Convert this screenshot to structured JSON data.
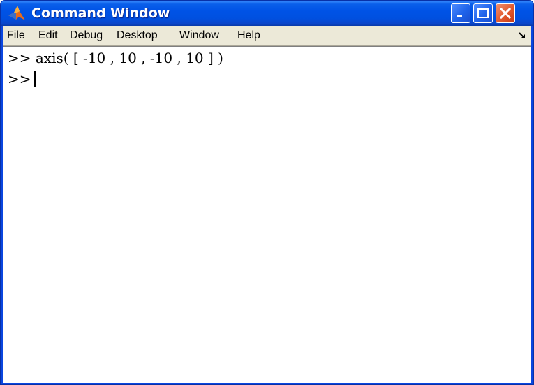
{
  "window": {
    "title": "Command Window",
    "app_icon": "matlab-icon",
    "controls": [
      "minimize-icon",
      "maximize-icon",
      "close-icon"
    ]
  },
  "menu": {
    "items": [
      "File",
      "Edit",
      "Debug",
      "Desktop",
      "Window",
      "Help"
    ],
    "undock_icon": "undock-arrow-icon"
  },
  "console": {
    "lines": [
      {
        "prompt": ">>",
        "command": "axis( [ -10 , 10 , -10 , 10 ] )"
      },
      {
        "prompt": ">>",
        "command": ""
      }
    ]
  },
  "colors": {
    "titlebar": "#0053e6",
    "close_button": "#e2582c",
    "menubar": "#ece9d8"
  }
}
